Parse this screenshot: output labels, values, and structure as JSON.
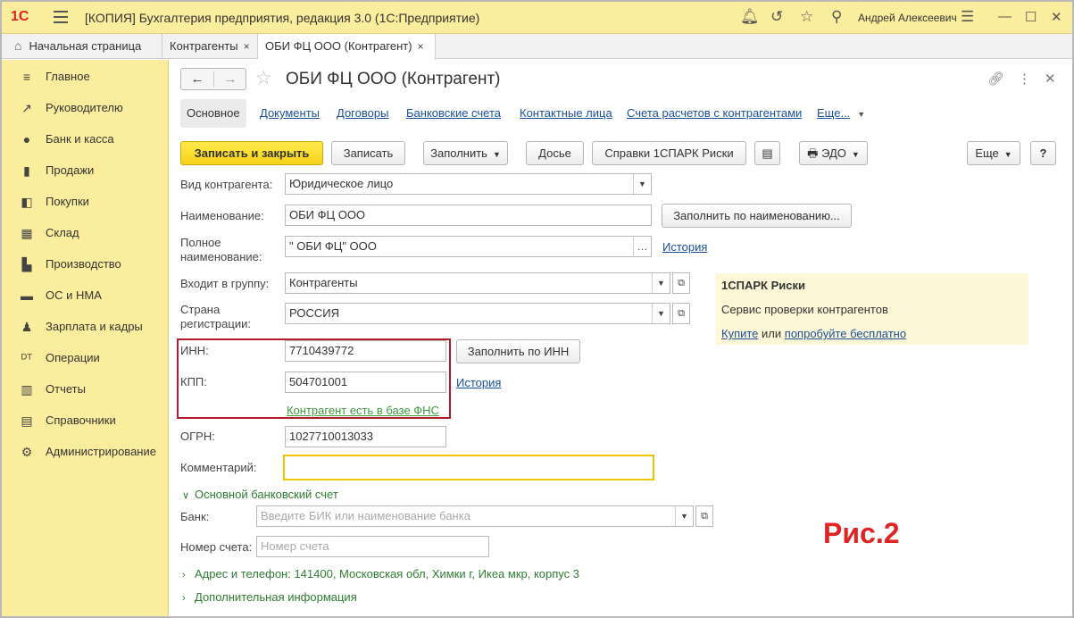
{
  "titlebar": {
    "logo": "1С",
    "title": "[КОПИЯ] Бухгалтерия предприятия, редакция 3.0  (1С:Предприятие)",
    "user": "Андрей Алексеевич"
  },
  "tabs": {
    "home": "Начальная страница",
    "counterparties": "Контрагенты",
    "current": "ОБИ ФЦ ООО (Контрагент)",
    "close": "×"
  },
  "sidebar": {
    "items": [
      {
        "label": "Главное",
        "icon": "≡"
      },
      {
        "label": "Руководителю",
        "icon": "↗"
      },
      {
        "label": "Банк и касса",
        "icon": "●"
      },
      {
        "label": "Продажи",
        "icon": "▮"
      },
      {
        "label": "Покупки",
        "icon": "◧"
      },
      {
        "label": "Склад",
        "icon": "▦"
      },
      {
        "label": "Производство",
        "icon": "▙"
      },
      {
        "label": "ОС и НМА",
        "icon": "▬"
      },
      {
        "label": "Зарплата и кадры",
        "icon": "♟"
      },
      {
        "label": "Операции",
        "icon": "ᴰᵀ"
      },
      {
        "label": "Отчеты",
        "icon": "▥"
      },
      {
        "label": "Справочники",
        "icon": "▤"
      },
      {
        "label": "Администрирование",
        "icon": "⚙"
      }
    ]
  },
  "form": {
    "title": "ОБИ ФЦ ООО (Контрагент)",
    "subtabs": [
      "Основное",
      "Документы",
      "Договоры",
      "Банковские счета",
      "Контактные лица",
      "Счета расчетов с контрагентами",
      "Еще..."
    ],
    "buttons": {
      "save_close": "Записать и закрыть",
      "save": "Записать",
      "fill": "Заполнить",
      "dossier": "Досье",
      "spark": "Справки 1СПАРК Риски",
      "edo": "ЭДО",
      "more": "Еще",
      "help": "?",
      "fill_by_name": "Заполнить по наименованию...",
      "fill_by_inn": "Заполнить по ИНН"
    },
    "labels": {
      "kind": "Вид контрагента:",
      "name": "Наименование:",
      "full_name_1": "Полное",
      "full_name_2": "наименование:",
      "group": "Входит в группу:",
      "country_1": "Страна",
      "country_2": "регистрации:",
      "inn": "ИНН:",
      "kpp": "КПП:",
      "ogrn": "ОГРН:",
      "comment": "Комментарий:",
      "bank": "Банк:",
      "account": "Номер счета:"
    },
    "values": {
      "kind": "Юридическое лицо",
      "name": "ОБИ ФЦ ООО",
      "full_name": "\" ОБИ ФЦ\" ООО",
      "group": "Контрагенты",
      "country": "РОССИЯ",
      "inn": "7710439772",
      "kpp": "504701001",
      "ogrn": "1027710013033",
      "comment": ""
    },
    "placeholders": {
      "bank": "Введите БИК или наименование банка",
      "account": "Номер счета"
    },
    "links": {
      "history_full": "История",
      "history_kpp": "История",
      "fns": "Контрагент есть в базе ФНС"
    },
    "groups": {
      "bank_account": "Основной банковский счет",
      "address": "Адрес и телефон: 141400, Московская обл, Химки г, Икеа мкр, корпус 3",
      "additional": "Дополнительная информация"
    },
    "spark": {
      "title": "1СПАРК Риски",
      "desc": "Сервис проверки контрагентов",
      "buy": "Купите",
      "or": "или",
      "try": "попробуйте бесплатно"
    }
  },
  "annotation": "Рис.2"
}
